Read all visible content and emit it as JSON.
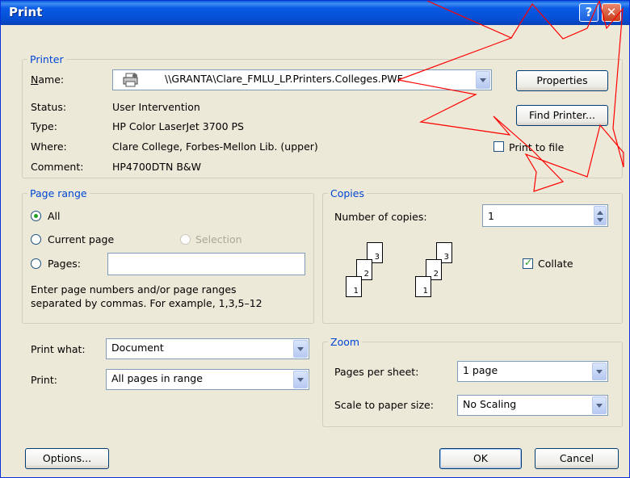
{
  "window": {
    "title": "Print",
    "help_glyph": "?",
    "close_glyph": "✕"
  },
  "printer": {
    "group_label": "Printer",
    "name_label": "Name:",
    "name_value": "\\\\GRANTA\\Clare_FMLU_LP.Printers.Colleges.PWF",
    "status_label": "Status:",
    "status_value": "User Intervention",
    "type_label": "Type:",
    "type_value": "HP Color LaserJet 3700 PS",
    "where_label": "Where:",
    "where_value": "Clare College, Forbes-Mellon Lib. (upper)",
    "comment_label": "Comment:",
    "comment_value": "HP4700DTN B&W",
    "properties_label": "Properties",
    "find_printer_label": "Find Printer...",
    "print_to_file_label": "Print to file",
    "print_to_file_checked": false
  },
  "page_range": {
    "group_label": "Page range",
    "all_label": "All",
    "current_page_label": "Current page",
    "selection_label": "Selection",
    "pages_label": "Pages:",
    "pages_value": "",
    "selected": "all",
    "hint_line1": "Enter page numbers and/or page ranges",
    "hint_line2": "separated by commas.  For example, 1,3,5–12"
  },
  "copies": {
    "group_label": "Copies",
    "number_label": "Number of copies:",
    "number_value": "1",
    "collate_label": "Collate",
    "collate_checked": true,
    "sheet_numbers": [
      "3",
      "2",
      "1"
    ]
  },
  "print_what": {
    "label": "Print what:",
    "value": "Document"
  },
  "print_select": {
    "label": "Print:",
    "value": "All pages in range"
  },
  "zoom": {
    "group_label": "Zoom",
    "pages_per_sheet_label": "Pages per sheet:",
    "pages_per_sheet_value": "1 page",
    "scale_label": "Scale to paper size:",
    "scale_value": "No Scaling"
  },
  "footer": {
    "options_label": "Options...",
    "ok_label": "OK",
    "cancel_label": "Cancel"
  },
  "colors": {
    "accent": "#0046d5",
    "title_blue": "#0551d6",
    "dialog_bg": "#ece9d8",
    "annotation_red": "#ff0000"
  }
}
